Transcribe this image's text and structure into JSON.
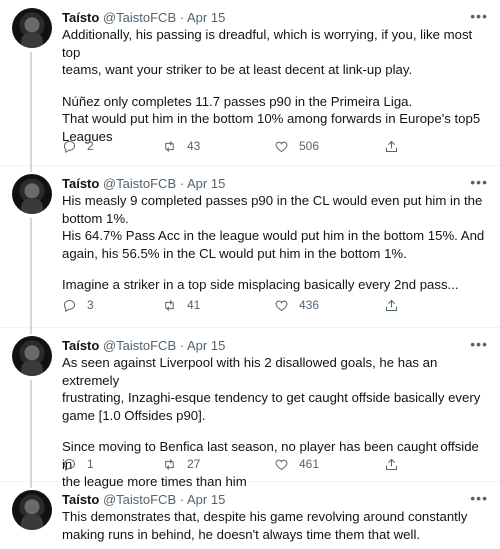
{
  "author": {
    "name": "Taísto",
    "handle": "@TaistoFCB",
    "separator": "·"
  },
  "tweets": [
    {
      "date": "Apr 15",
      "more": "•••",
      "lines": [
        "Additionally, his passing is dreadful, which is worrying, if you, like most top",
        "teams, want your striker to be at least decent at link-up play.",
        "",
        "Núñez only completes 11.7 passes p90 in the Primeira Liga.",
        "That would put him in the bottom 10% among forwards in Europe's top5",
        "Leagues"
      ],
      "replies": "2",
      "retweets": "43",
      "likes": "506"
    },
    {
      "date": "Apr 15",
      "more": "•••",
      "lines": [
        "His measly 9 completed passes p90 in the CL would even put him in the",
        "bottom 1%.",
        "His 64.7% Pass Acc in the league would put him in the bottom 15%. And",
        "again, his 56.5% in the CL would put him in the bottom 1%.",
        "",
        "Imagine a striker in a top side misplacing basically every 2nd pass..."
      ],
      "replies": "3",
      "retweets": "41",
      "likes": "436"
    },
    {
      "date": "Apr 15",
      "more": "•••",
      "lines": [
        "As seen against Liverpool with his 2 disallowed goals, he has an extremely",
        "frustrating, Inzaghi-esque tendency to get caught offside basically every",
        "game [1.0 Offsides p90].",
        "",
        "Since moving to Benfica last season, no player has been caught offside in",
        "the league more times than him"
      ],
      "replies": "1",
      "retweets": "27",
      "likes": "461"
    },
    {
      "date": "Apr 15",
      "more": "•••",
      "lines": [
        "This demonstrates that, despite his game revolving around constantly",
        "making runs in behind, he doesn't always time them that well."
      ]
    }
  ],
  "icons": {
    "reply": "reply-icon",
    "retweet": "retweet-icon",
    "like": "heart-icon",
    "share": "share-icon",
    "more": "more-icon"
  }
}
